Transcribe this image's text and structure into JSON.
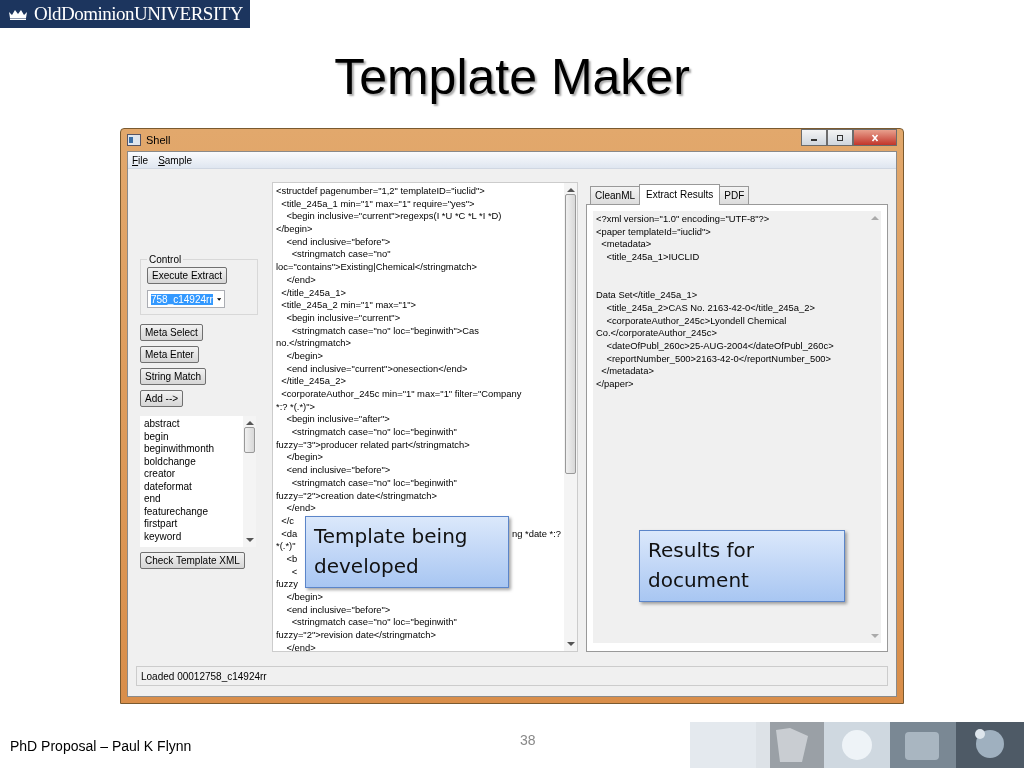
{
  "header": {
    "logo_text": "OldDominionUNIVERSITY"
  },
  "slide_title": "Template Maker",
  "window": {
    "title": "Shell",
    "menu": [
      "File",
      "Sample"
    ],
    "control_group": {
      "label": "Control",
      "button": "Execute Extract",
      "combo_value": "758_c14924rr"
    },
    "buttons": [
      "Meta Select",
      "Meta Enter",
      "String Match",
      "Add -->"
    ],
    "tag_list": [
      "abstract",
      "begin",
      "beginwithmonth",
      "boldchange",
      "creator",
      "dateformat",
      "end",
      "featurechange",
      "firstpart",
      "keyword"
    ],
    "check_button": "Check Template XML",
    "editor_lines": [
      {
        "text": "<structdef pagenumber=\"1,2\" templateID=\"iuclid\">"
      },
      {
        "text": "  <title_245a_1 min=\"1\" max=\"1\" require=\"yes\">"
      },
      {
        "text": "    <begin inclusive=\"current\">regexps(I *U *C *L *I *D)"
      },
      {
        "text": "</begin>"
      },
      {
        "text": "    <end inclusive=\"before\">"
      },
      {
        "text": "      <stringmatch case=\"no\""
      },
      {
        "text": "loc=\"contains\">Existing|Chemical</stringmatch>"
      },
      {
        "text": "    </end>"
      },
      {
        "text": "  </title_245a_1>"
      },
      {
        "text": "  <title_245a_2 min=\"1\" max=\"1\">"
      },
      {
        "text": "    <begin inclusive=\"current\">"
      },
      {
        "text": "      <stringmatch case=\"no\" loc=\"beginwith\">Cas"
      },
      {
        "text": "no.</stringmatch>"
      },
      {
        "text": "    </begin>"
      },
      {
        "text": "    <end inclusive=\"current\">onesection</end>"
      },
      {
        "text": "  </title_245a_2>"
      },
      {
        "text": "  <corporateAuthor_245c min=\"1\" max=\"1\" filter=\"Company"
      },
      {
        "text": "*:? *(.*)\">"
      },
      {
        "text": "    <begin inclusive=\"after\">"
      },
      {
        "text": "      <stringmatch case=\"no\" loc=\"beginwith\""
      },
      {
        "text": "fuzzy=\"3\">producer related part</stringmatch>"
      },
      {
        "text": "    </begin>"
      },
      {
        "text": "    <end inclusive=\"before\">"
      },
      {
        "text": "      <stringmatch case=\"no\" loc=\"beginwith\""
      },
      {
        "text": "fuzzy=\"2\">creation date</stringmatch>"
      },
      {
        "text": "    </end>"
      },
      {
        "text": "  </c"
      },
      {
        "text": "  <da",
        "tail": "ng *date *:?"
      },
      {
        "text": "*(.*)\""
      },
      {
        "text": "    <b"
      },
      {
        "text": "      <"
      },
      {
        "text": "fuzzy"
      },
      {
        "text": "    </begin>"
      },
      {
        "text": "    <end inclusive=\"before\">"
      },
      {
        "text": "      <stringmatch case=\"no\" loc=\"beginwith\""
      },
      {
        "text": "fuzzy=\"2\">revision date</stringmatch>"
      },
      {
        "text": "    </end>"
      }
    ],
    "result_tabs": [
      {
        "label": "CleanML",
        "selected": false
      },
      {
        "label": "Extract Results",
        "selected": true
      },
      {
        "label": "PDF",
        "selected": false
      }
    ],
    "result_text": "<?xml version=\"1.0\" encoding=\"UTF-8\"?>\n<paper templateId=\"iuclid\">\n  <metadata>\n    <title_245a_1>IUCLID\n\n\nData Set</title_245a_1>\n    <title_245a_2>CAS No. 2163-42-0</title_245a_2>\n    <corporateAuthor_245c>Lyondell Chemical\nCo.</corporateAuthor_245c>\n    <dateOfPubl_260c>25-AUG-2004</dateOfPubl_260c>\n    <reportNumber_500>2163-42-0</reportNumber_500>\n  </metadata>\n</paper>",
    "status": "Loaded 00012758_c14924rr"
  },
  "callouts": [
    {
      "kind": "editor",
      "text": "Template being developed"
    },
    {
      "kind": "results",
      "text": "Results for document"
    }
  ],
  "footer": {
    "author": "PhD Proposal – Paul K Flynn",
    "page": "38"
  }
}
